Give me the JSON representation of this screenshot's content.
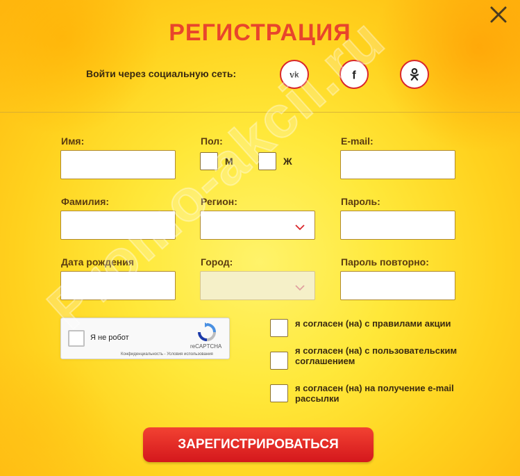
{
  "title": "РЕГИСТРАЦИЯ",
  "social": {
    "label": "Войти через социальную сеть:",
    "networks": [
      "vk-icon",
      "facebook-icon",
      "odnoklassniki-icon"
    ]
  },
  "fields": {
    "name": {
      "label": "Имя:",
      "value": ""
    },
    "gender": {
      "label": "Пол:",
      "options": [
        "М",
        "Ж"
      ]
    },
    "email": {
      "label": "E-mail:",
      "value": ""
    },
    "surname": {
      "label": "Фамилия:",
      "value": ""
    },
    "region": {
      "label": "Регион:",
      "value": ""
    },
    "password": {
      "label": "Пароль:",
      "value": ""
    },
    "birthdate": {
      "label": "Дата рождения",
      "value": ""
    },
    "city": {
      "label": "Город:",
      "value": ""
    },
    "password_repeat": {
      "label": "Пароль повторно:",
      "value": ""
    }
  },
  "captcha": {
    "text": "Я не робот",
    "brand": "reCAPTCHA",
    "links": "Конфиденциальность - Условия использования"
  },
  "agreements": [
    "я согласен (на) с правилами акции",
    "я согласен (на) с пользовательским соглашением",
    "я согласен (на) на получение e-mail рассылки"
  ],
  "submit_label": "ЗАРЕГИСТРИРОВАТЬСЯ",
  "watermark": "Promo-akcii.ru",
  "colors": {
    "accent": "#e8452c",
    "button": "#d4171c",
    "social_border": "#d9262b"
  }
}
